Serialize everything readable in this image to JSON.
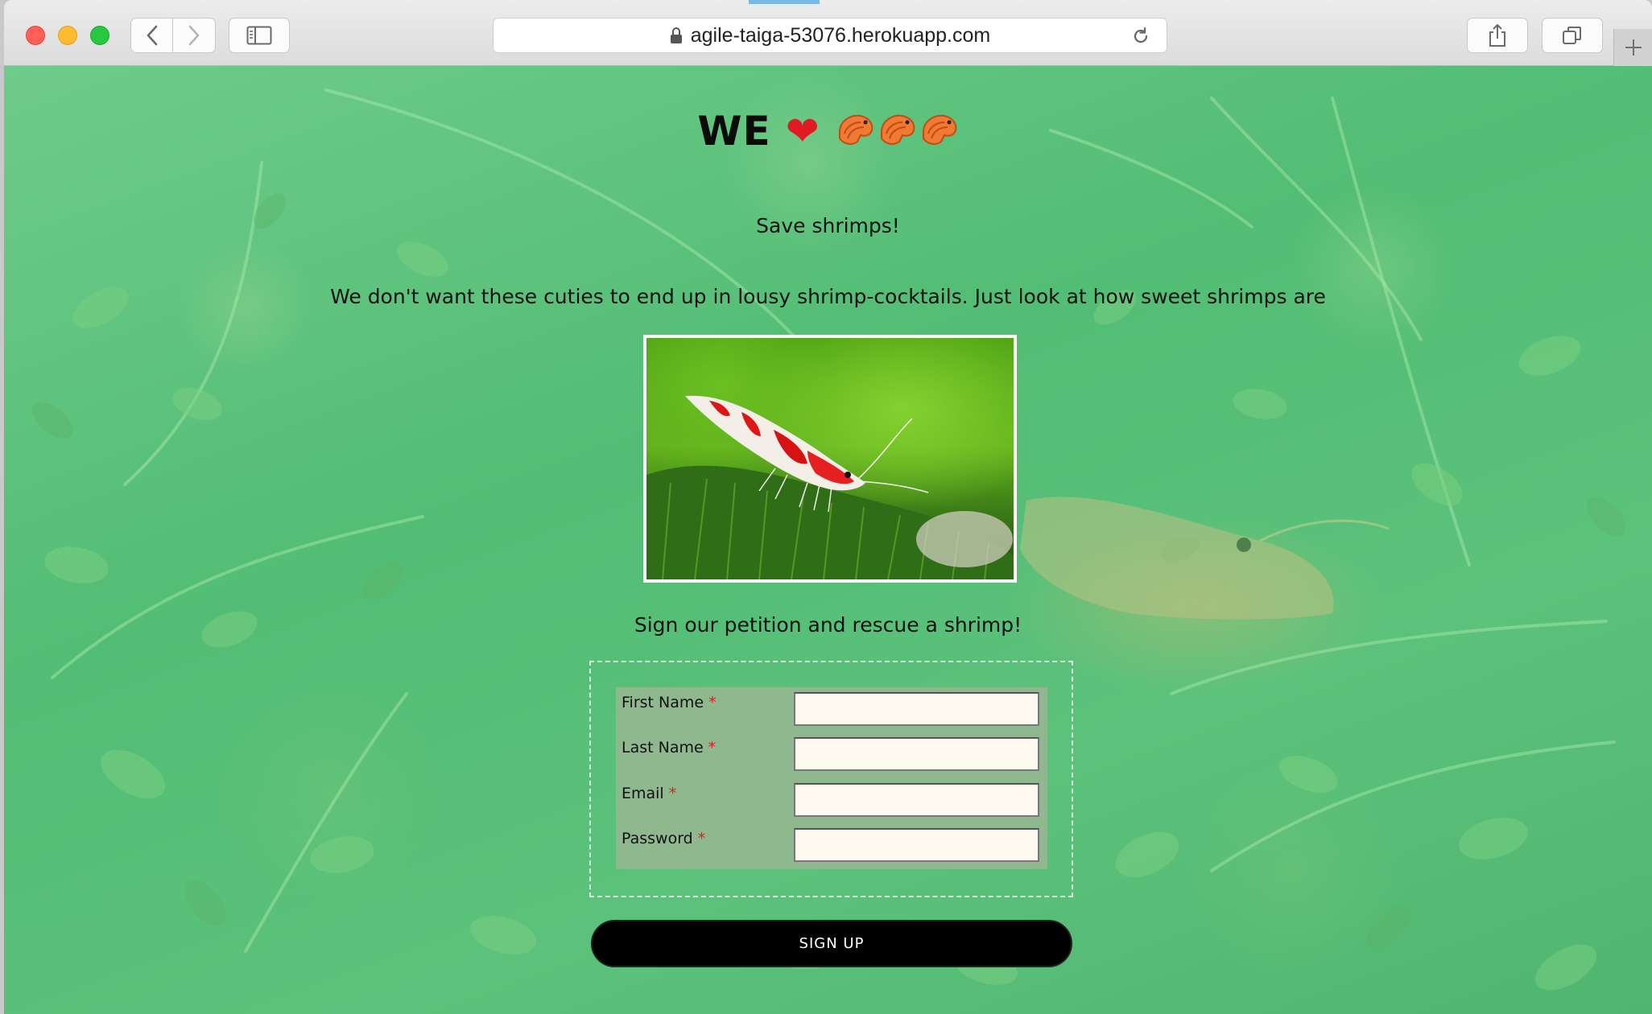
{
  "browser": {
    "url": "agile-taiga-53076.herokuapp.com"
  },
  "page": {
    "headline": "WE",
    "heart": "❤",
    "subtitle": "Save shrimps!",
    "description": "We don't want these cuties to end up in lousy shrimp-cocktails. Just look at how sweet shrimps are",
    "petition_text": "Sign our petition and rescue a shrimp!",
    "form": {
      "fields": [
        {
          "label": "First Name",
          "required": "*",
          "value": ""
        },
        {
          "label": "Last Name",
          "required": "*",
          "value": ""
        },
        {
          "label": "Email",
          "required": "*",
          "value": ""
        },
        {
          "label": "Password",
          "required": "*",
          "value": ""
        }
      ],
      "submit_label": "SIGN UP"
    }
  },
  "colors": {
    "background_green": "#52bd74",
    "form_table": "#8fb88e",
    "input_bg": "#fffaf0",
    "required_star": "#e01b24",
    "button_bg": "#000000"
  },
  "icons": [
    "back-chevron-icon",
    "forward-chevron-icon",
    "sidebar-icon",
    "lock-icon",
    "reload-icon",
    "share-icon",
    "tabs-overview-icon",
    "plus-icon",
    "heart-emoji-icon",
    "shrimp-emoji-icon"
  ]
}
